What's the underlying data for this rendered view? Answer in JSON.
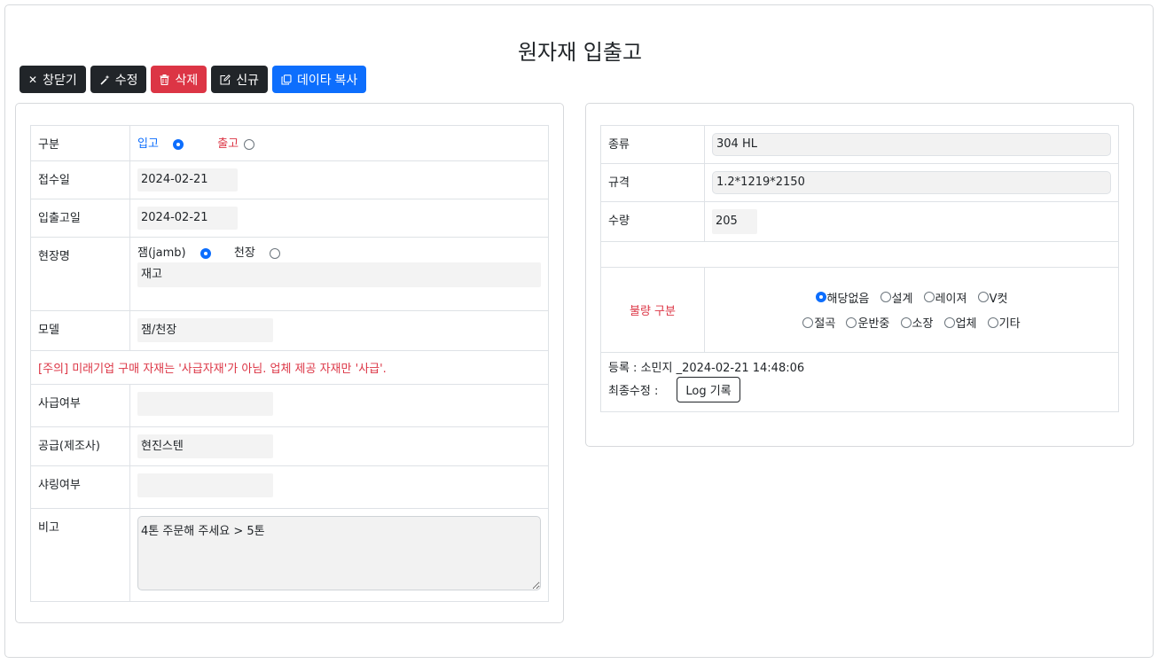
{
  "title": "원자재 입출고",
  "toolbar": {
    "close": "창닫기",
    "edit": "수정",
    "delete": "삭제",
    "new": "신규",
    "copy": "데이타 복사"
  },
  "left": {
    "type_label": "구분",
    "type_in": "입고",
    "type_out": "출고",
    "type_selected": "입고",
    "receipt_date_label": "접수일",
    "receipt_date": "2024-02-21",
    "io_date_label": "입출고일",
    "io_date": "2024-02-21",
    "site_label": "현장명",
    "site_opt1": "잼(jamb)",
    "site_opt2": "천장",
    "site_selected": "잼(jamb)",
    "site_value": "재고",
    "model_label": "모델",
    "model_value": "잼/천장",
    "notice": "[주의] 미래기업 구매 자재는 '사급자재'가 아님. 업체 제공 자재만 '사급'.",
    "supplied_label": "사급여부",
    "supplied_value": "",
    "supplier_label": "공급(제조사)",
    "supplier_value": "현진스텐",
    "shearing_label": "샤링여부",
    "shearing_value": "",
    "remark_label": "비고",
    "remark_value": "4톤 주문해 주세요 > 5톤"
  },
  "right": {
    "kind_label": "종류",
    "kind_value": "304 HL",
    "spec_label": "규격",
    "spec_value": "1.2*1219*2150",
    "qty_label": "수량",
    "qty_value": "205",
    "defect_label": "불량 구분",
    "defect_options_row1": [
      "해당없음",
      "설계",
      "레이져",
      "V컷"
    ],
    "defect_options_row2": [
      "절곡",
      "운반중",
      "소장",
      "업체",
      "기타"
    ],
    "defect_selected": "해당없음",
    "registered": "등록 : 소민지 _2024-02-21 14:48:06",
    "last_modified_label": "최종수정 :",
    "log_button": "Log 기록"
  },
  "colors": {
    "dark": "#212529",
    "danger": "#dc3545",
    "primary": "#0d6efd"
  }
}
